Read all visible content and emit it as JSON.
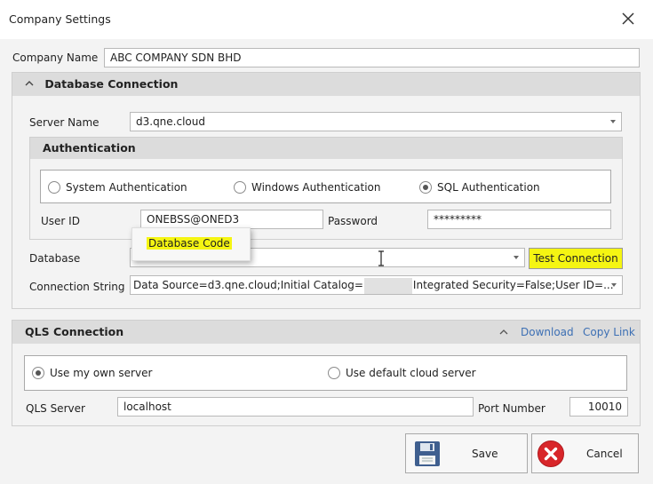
{
  "window": {
    "title": "Company Settings"
  },
  "company": {
    "label": "Company Name",
    "value": "ABC COMPANY SDN BHD"
  },
  "database_connection": {
    "header": "Database Connection",
    "server_label": "Server Name",
    "server_value": "d3.qne.cloud",
    "authentication": {
      "header": "Authentication",
      "options": [
        {
          "label": "System Authentication",
          "selected": false
        },
        {
          "label": "Windows Authentication",
          "selected": false
        },
        {
          "label": "SQL Authentication",
          "selected": true
        }
      ],
      "user_id_label": "User ID",
      "user_id_value": "ONEBSS@ONED3",
      "password_label": "Password",
      "password_value": "*********"
    },
    "database_label": "Database",
    "database_value": "",
    "test_connection_label": "Test Connection",
    "connection_string_label": "Connection String",
    "connection_string_start": "Data Source=d3.qne.cloud;Initial Catalog=",
    "connection_string_end": "Integrated Security=False;User ID=...",
    "tooltip_text": "Database Code"
  },
  "qls_connection": {
    "header": "QLS Connection",
    "download_label": "Download",
    "copy_link_label": "Copy Link",
    "options": [
      {
        "label": "Use my own server",
        "selected": true
      },
      {
        "label": "Use default cloud server",
        "selected": false
      }
    ],
    "server_label": "QLS Server",
    "server_value": "localhost",
    "port_label": "Port Number",
    "port_value": "10010"
  },
  "actions": {
    "save_label": "Save",
    "cancel_label": "Cancel"
  },
  "colors": {
    "highlight": "#f5f512",
    "link": "#3c6fb4",
    "cancel_red": "#d8262a",
    "save_blue": "#3f5f8f"
  }
}
